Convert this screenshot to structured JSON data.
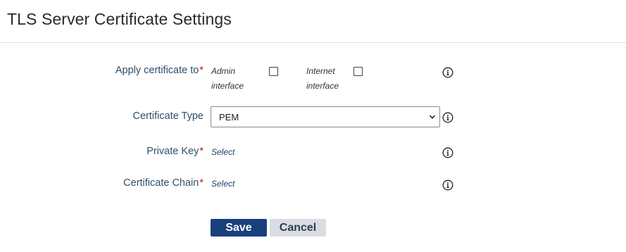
{
  "header": {
    "title": "TLS Server Certificate Settings"
  },
  "form": {
    "apply_to": {
      "label": "Apply certificate to",
      "required_mark": "*",
      "options": [
        {
          "line1": "Admin",
          "line2": "interface",
          "checked": false
        },
        {
          "line1": "Internet",
          "line2": "interface",
          "checked": false
        }
      ]
    },
    "certificate_type": {
      "label": "Certificate Type",
      "value": "PEM"
    },
    "private_key": {
      "label": "Private Key",
      "required_mark": "*",
      "link": "Select"
    },
    "certificate_chain": {
      "label": "Certificate Chain",
      "required_mark": "*",
      "link": "Select"
    }
  },
  "buttons": {
    "save": "Save",
    "cancel": "Cancel"
  },
  "icons": {
    "info": "info-icon",
    "dropdown": "chevron-down-icon"
  },
  "colors": {
    "label": "#2d4f6b",
    "required": "#c8102e",
    "primary": "#1a3f7d",
    "secondary": "#d9dde2"
  }
}
